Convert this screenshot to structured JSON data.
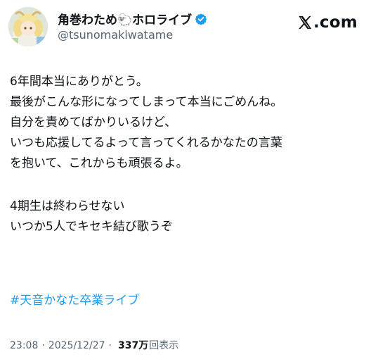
{
  "author": {
    "display_name": "角巻わため🐑ホロライブ",
    "handle": "@tsunomakiwatame",
    "verified": true
  },
  "brand": {
    "text": ".com"
  },
  "tweet": {
    "lines": [
      "6年間本当にありがとう。",
      "最後がこんな形になってしまって本当にごめんね。",
      "自分を責めてばかりいるけど、",
      "いつも応援してるよって言ってくれるかなたの言葉",
      "を抱いて、これからも頑張るよ。",
      "4期生は終わらせない",
      "いつか5人でキセキ結び歌うぞ"
    ],
    "hashtag": "#天音かなた卒業ライブ"
  },
  "meta": {
    "time": "23:08",
    "separator": "·",
    "date": "2025/12/27",
    "views_count": "337万",
    "views_label": "回表示"
  },
  "colors": {
    "text": "#0f1419",
    "secondary": "#536471",
    "link": "#1d9bf0",
    "verified": "#1d9bf0"
  }
}
